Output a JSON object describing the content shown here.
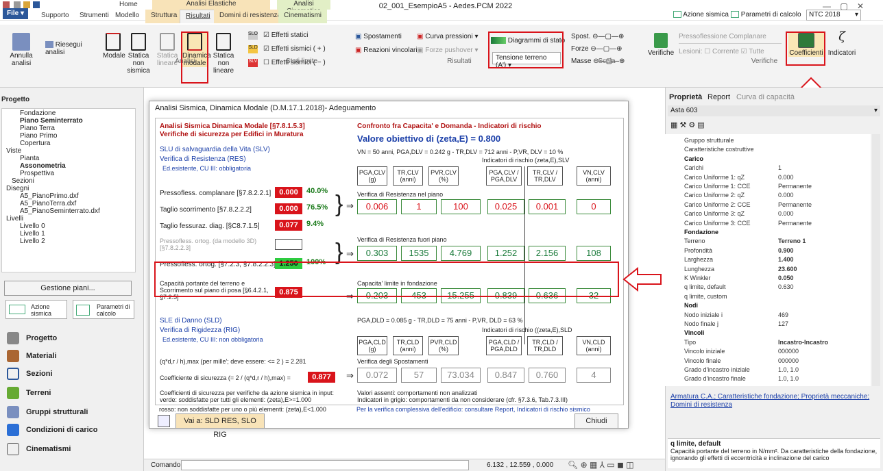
{
  "app": {
    "title": "02_001_EsempioA5 - Aedes.PCM 2022",
    "file_label": "File ▾",
    "accent": "#2b579a"
  },
  "ribbon": {
    "contexts": {
      "elastic": "Analisi Elastiche",
      "cinematic": "Analisi Cinematica"
    },
    "tabs": [
      "Supporto",
      "Strumenti",
      "Modello",
      "Struttura",
      "Risultati",
      "Domini di resistenza",
      "Cinematismi"
    ],
    "home_tab": "Home",
    "buttons": {
      "annulla": "Annulla analisi",
      "riesegui": "Riesegui analisi",
      "modale": "Modale",
      "statica_ns": "Statica non sismica",
      "statica_lin": "Statica lineare",
      "dinamica_modale": "Dinamica modale",
      "statica_nonlin": "Statica non lineare",
      "sld": "SLD",
      "slo": "SLO",
      "slv": "SLV",
      "effetti_statici": "Effetti statici",
      "effetti_pos": "Effetti sismici ( + )",
      "effetti_neg": "Effetti sismici ( − )",
      "spostamenti": "Spostamenti",
      "reazioni": "Reazioni vincolari",
      "curva": "Curva pressioni",
      "forze_pushover": "Forze pushover",
      "diagrammi": "Diagrammi di stato",
      "tensione": "Tensione terreno (A')",
      "spost": "Spost.",
      "forze": "Forze",
      "masse": "Masse",
      "verifiche": "Verifiche",
      "presso": "Pressoflessione Complanare",
      "lesioni": "Lesioni:",
      "corrente": "Corrente",
      "tutte": "Tutte",
      "coefficienti": "Coefficienti",
      "indicatori": "Indicatori"
    },
    "groups": {
      "analisi": "Analisi",
      "stati": "Stati limite",
      "risultati": "Risultati",
      "scala": "Scala",
      "verifiche": "Verifiche"
    },
    "top_right": {
      "azione": "Azione sismica",
      "parametri": "Parametri di calcolo",
      "ntc": "NTC 2018"
    }
  },
  "left": {
    "title": "Progetto",
    "tree": [
      "Fondazione",
      "Piano Seminterrato",
      "Piano Terra",
      "Piano Primo",
      "Copertura",
      "Viste",
      "Pianta",
      "Assonometria",
      "Prospettiva",
      "Sezioni",
      "Disegni",
      "A5_PianoPrimo.dxf",
      "A5_PianoTerra.dxf",
      "A5_PianoSeminterrato.dxf",
      "Livelli",
      "Livello 0",
      "Livello 1",
      "Livello 2"
    ],
    "gestione": "Gestione piani...",
    "azione": "Azione sismica",
    "parametri": "Parametri di calcolo",
    "nav": [
      "Progetto",
      "Materiali",
      "Sezioni",
      "Terreni",
      "Gruppi strutturali",
      "Condizioni di carico",
      "Cinematismi"
    ]
  },
  "dialog": {
    "title": "Analisi Sismica, Dinamica Modale (D.M.17.1.2018)- Adeguamento",
    "h1": "Analisi Sismica Dinamica Modale [§7.8.1.5.3]",
    "h2": "Verifiche di sicurezza per Edifici in Muratura",
    "h3": "Confronto fra Capacita' e Domanda - Indicatori di rischio",
    "obiettivo": "Valore obiettivo di (zeta,E) = 0.800",
    "slv": "SLU di salvaguardia della Vita (SLV)",
    "res": "Verifica di Resistenza (RES)",
    "ed1": "Ed.esistente, CU III: obbligatoria",
    "vn_slv": "VN = 50 anni, PGA,DLV = 0.242 g - TR,DLV = 712 anni - P,VR, DLV = 10 %",
    "ind_slv": "Indicatori di rischio (zeta,E),SLV",
    "hdr_slv": [
      "PGA,CLV\n(g)",
      "TR,CLV\n(anni)",
      "PVR,CLV\n(%)",
      "PGA,CLV /\nPGA,DLV",
      "TR,CLV /\nTR,DLV",
      "VN,CLV\n(anni)"
    ],
    "rows": [
      {
        "label": "Pressofless. complanare [§7.8.2.2.1]",
        "val": "0.000",
        "pct": "40.0%"
      },
      {
        "label": "Taglio scorrimento [§7.8.2.2.2]",
        "val": "0.000",
        "pct": "76.5%"
      },
      {
        "label": "Taglio fessuraz. diag. [§C8.7.1.5]",
        "val": "0.077",
        "pct": "9.4%"
      },
      {
        "label": "Pressofless. ortog. (da modello 3D)\n[§7.8.2.2.3]",
        "val": "",
        "pct": ""
      },
      {
        "label": "Pressofless. ortog. [§7.2.3, §7.8.2.2.3]",
        "val": "1.250",
        "pct": "100%"
      }
    ],
    "piano": "Verifica di Resistenza nel piano",
    "piano_vals": [
      "0.006",
      "1",
      "100",
      "0.025",
      "0.001",
      "0"
    ],
    "fuori": "Verifica di Resistenza fuori piano",
    "fuori_vals": [
      "0.303",
      "1535",
      "4.769",
      "1.252",
      "2.156",
      "108"
    ],
    "cap_label": "Capacità portante del terreno e\nScorrimento sul piano di posa [§6.4.2.1,\n§7.2.5]",
    "cap_val": "0.875",
    "cap_title": "Capacita' limite in fondazione",
    "cap_vals": [
      "0.203",
      "453",
      "15.255",
      "0.839",
      "0.636",
      "32"
    ],
    "sld": "SLE di Danno (SLD)",
    "rig": "Verifica di Rigidezza (RIG)",
    "ed2": "Ed.esistente, CU III: non obbligatoria",
    "vn_sld": "PGA,DLD = 0.085 g - TR,DLD = 75 anni - P,VR, DLD = 63 %",
    "ind_sld": "Indicatori di rischio ((zeta,E),SLD",
    "hdr_sld": [
      "PGA,CLD\n(g)",
      "TR,CLD\n(anni)",
      "PVR,CLD\n(%)",
      "PGA,CLD /\nPGA,DLD",
      "TR,CLD /\nTR,DLD",
      "VN,CLD\n(anni)"
    ],
    "qd": "(q*d,r / h),max (per mille'; deve essere: <= 2 ) = 2.281",
    "coef_label": "Coefficiente di sicurezza (= 2 / (q*d,r / h),max) =",
    "coef_val": "0.877",
    "spost": "Verifica degli Spostamenti",
    "spost_vals": [
      "0.072",
      "57",
      "73.034",
      "0.847",
      "0.760",
      "4"
    ],
    "note1": "Coefficienti di sicurezza per verifiche da azione sismica in input:",
    "note2": "verde: soddisfatte per tutti gli elementi: (zeta),E>=1.000",
    "note3": "rosso: non soddisfatte per uno o più elementi: (zeta),E<1.000",
    "note4": "Valori assenti: comportamenti non analizzati",
    "note5": "Indicatori in grigio: comportamenti da non considerare (cfr. §7.3.6, Tab.7.3.III)",
    "note6": "Per la verifica complessiva dell'edificio: consultare Report, Indicatori di rischio sismico",
    "vai": "Vai a: SLD RES, SLO RIG",
    "chiudi": "Chiudi"
  },
  "right": {
    "tabs": [
      "Proprietà",
      "Report",
      "Curva di capacità"
    ],
    "selected": "Asta 603",
    "props": [
      [
        "Gruppo strutturale",
        ""
      ],
      [
        "Caratteristiche costruttive",
        ""
      ],
      [
        "Carico",
        ""
      ],
      [
        "Carichi",
        "1"
      ],
      [
        "Carico Uniforme 1: qZ",
        "0.000"
      ],
      [
        "Carico Uniforme 1: CCE",
        "Permanente"
      ],
      [
        "Carico Uniforme 2: qZ",
        "0.000"
      ],
      [
        "Carico Uniforme 2: CCE",
        "Permanente"
      ],
      [
        "Carico Uniforme 3: qZ",
        "0.000"
      ],
      [
        "Carico Uniforme 3: CCE",
        "Permanente"
      ],
      [
        "Fondazione",
        ""
      ],
      [
        "Terreno",
        "Terreno 1"
      ],
      [
        "Profondità",
        "0.900"
      ],
      [
        "Larghezza",
        "1.400"
      ],
      [
        "Lunghezza",
        "23.600"
      ],
      [
        "K Winkler",
        "0.050"
      ],
      [
        "q limite, default",
        "0.630"
      ],
      [
        "q limite, custom",
        ""
      ],
      [
        "Nodi",
        ""
      ],
      [
        "Nodo iniziale i",
        "469"
      ],
      [
        "Nodo finale j",
        "127"
      ],
      [
        "Vincoli",
        ""
      ],
      [
        "Tipo",
        "Incastro-Incastro"
      ],
      [
        "Vincolo iniziale",
        "000000"
      ],
      [
        "Vincolo finale",
        "000000"
      ],
      [
        "Grado d'incastro iniziale",
        "1.0, 1.0"
      ],
      [
        "Grado d'incastro finale",
        "1.0, 1.0"
      ]
    ],
    "links": "Armatura C.A.; Caratteristiche fondazione; Proprietà meccaniche; Domini di resistenza",
    "help_title": "q limite, default",
    "help_text": "Capacità portante del terreno in N/mm². Da caratteristiche della fondazione, ignorando gli effetti di eccentricità e inclinazione del carico"
  },
  "status": {
    "comando": "Comando",
    "coords": "6.132 , 12.559 , 0.000"
  }
}
